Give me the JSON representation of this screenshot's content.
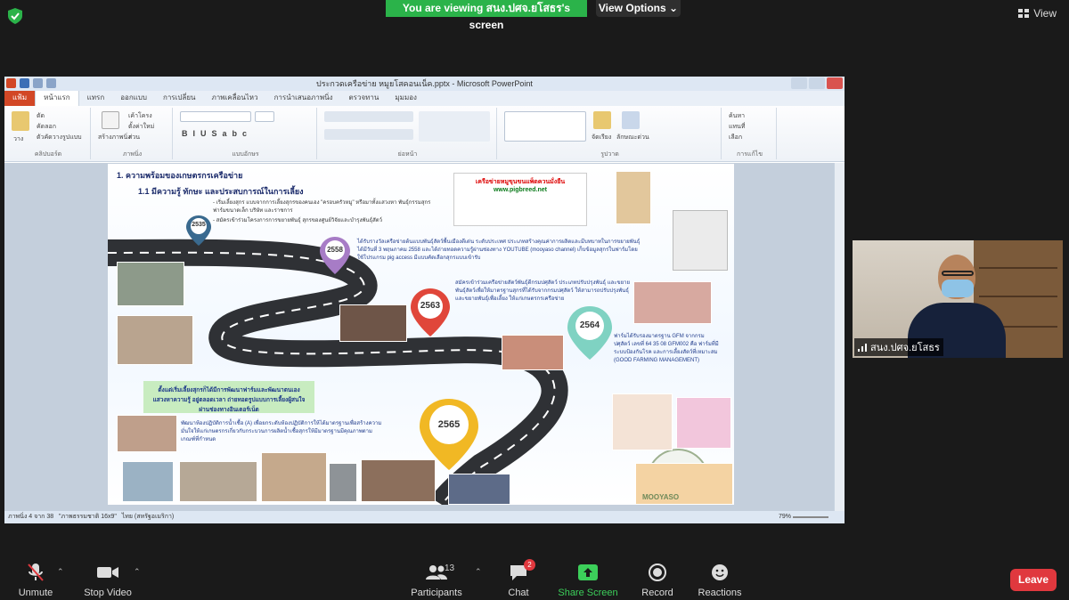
{
  "zoom": {
    "viewing_banner": "You are viewing สนง.ปศจ.ยโสธร's screen",
    "view_options_label": "View Options",
    "view_label": "View",
    "participant_name": "สนง.ปศจ.ยโสธร",
    "participants_count": "13",
    "chat_badge": "2",
    "toolbar": {
      "unmute": "Unmute",
      "stop_video": "Stop Video",
      "participants": "Participants",
      "chat": "Chat",
      "share_screen": "Share Screen",
      "record": "Record",
      "reactions": "Reactions",
      "leave": "Leave"
    }
  },
  "powerpoint": {
    "window_title": "ประกวดเครือข่าย หมูยโสคอนเน็ค.pptx - Microsoft PowerPoint",
    "tabs": [
      "แฟ้ม",
      "หน้าแรก",
      "แทรก",
      "ออกแบบ",
      "การเปลี่ยน",
      "ภาพเคลื่อนไหว",
      "การนำเสนอภาพนิ่ง",
      "ตรวจทาน",
      "มุมมอง"
    ],
    "ribbon_groups": [
      "คลิปบอร์ด",
      "ภาพนิ่ง",
      "แบบอักษร",
      "ย่อหน้า",
      "รูปวาด",
      "การแก้ไข"
    ],
    "ribbon_buttons": {
      "paste": "วาง",
      "cut": "ตัด",
      "copy": "คัดลอก",
      "format_painter": "ตัวคัดวางรูปแบบ",
      "new_slide": "สร้างภาพนิ่ง",
      "layout": "เค้าโครง",
      "reset": "ตั้งค่าใหม่",
      "section": "ส่วน",
      "arrange": "จัดเรียง",
      "quick_styles": "ลักษณะด่วน",
      "find": "ค้นหา",
      "replace": "แทนที่",
      "select": "เลือก"
    },
    "status": {
      "slide_pos": "ภาพนิ่ง 4 จาก 38",
      "theme": "\"ภาพธรรมชาติ 16x9\"",
      "language": "ไทย (สหรัฐอเมริกา)",
      "zoom": "79%"
    }
  },
  "slide": {
    "heading1": "1. ความพร้อมของเกษตรกรเครือข่าย",
    "heading2": "1.1 มีความรู้ ทักษะ และประสบการณ์ในการเลี้ยง",
    "bullet1": "- เริ่มเลี้ยงสุกร แบบจากการเลี้ยงสุกรของคนเอง \"ครอบครัวหมู\" หรือมาทั้งแสวงหา พันธุ์กรรมสุกรฟาร์มขนาดเล็ก บริษัท และราชการ",
    "bullet2": "- สมัครเข้าร่วมโครงการการขยายพันธุ์ สุกรของศูนย์วิจัยและบำรุงพันธุ์สัตว์",
    "text2558": "ได้รับรางวัลเครือข่ายต้นแบบพันธุ์สัตว์พื้นเมืองดีเด่น ระดับประเทศ ประเภทสร้างคุณค่าการผลิตและมีบทบาทในการขยายพันธุ์ ได้มีวันที่ 3 พฤษภาคม 2558 และได้ถ่ายทอดความรู้ผ่านช่องทาง YOUTUBE (mooyaso channel) เก็บข้อมูลสุกรในฟาร์มโดยใช้โปรแกรม pig access มีแบบคัดเลือกสุกรแบบเข้ารับ",
    "text2563": "สมัครเข้าร่วมเครือข่ายสัตว์พันธุ์ดีกรมปศุสัตว์ ประเภทปรับปรุงพันธุ์ และขยายพันธุ์สัตว์เพื่อให้มาตรฐานสุกรที่ได้รับจากกรมปศุสัตว์ ให้สามารถปรับปรุงพันธุ์และขยายพันธุ์เพื่อเลี้ยง ให้แก่เกษตรกรเครือข่าย",
    "text2564": "ฟาร์มได้รับรองมาตรฐาน GFM จากกรมปศุสัตว์ เลขที่ 64 35 08 GFM002 คือ ฟาร์มที่มีระบบป้องกันโรค และการเลี้ยงสัตว์ที่เหมาะสม (GOOD FARMING MANAGEMENT)",
    "green_box": "ตั้งแต่เริ่มเลี้ยงสุกรก็ได้มีการพัฒนาฟาร์มและพัฒนาตนเอง แสวงหาความรู้ อยู่ตลอดเวลา ถ่ายทอดรูปแบบการเลี้ยงผู้สนใจ ผ่านช่องทางอินเตอร์เน็ต",
    "text2565": "พัฒนาห้องปฏิบัติการน้ำเชื้อ (A) เพื่อยกระดับห้องปฏิบัติการให้ได้มาตรฐานเพื่อสร้างความมั่นใจให้แก่เกษตรกรเกี่ยวกับกระบวนการผลิตน้ำเชื้อสุกรให้มีมาตรฐานมีคุณภาพตามเกณฑ์ที่กำหนด",
    "banner_title": "เครือข่ายหมูขุนขนแพ็ดควนมั่งยืน",
    "banner_url": "www.pigbreed.net",
    "years": [
      "2535",
      "2558",
      "2563",
      "2564",
      "2565"
    ],
    "mooyaso": "MOOYASO",
    "colors": {
      "road": "#2f3135",
      "pin2535": "#3a6a8f",
      "pin2558": "#a77cc6",
      "pin2563": "#e0463a",
      "pin2564": "#7fd2c2",
      "pin2565": "#f1b824"
    }
  }
}
